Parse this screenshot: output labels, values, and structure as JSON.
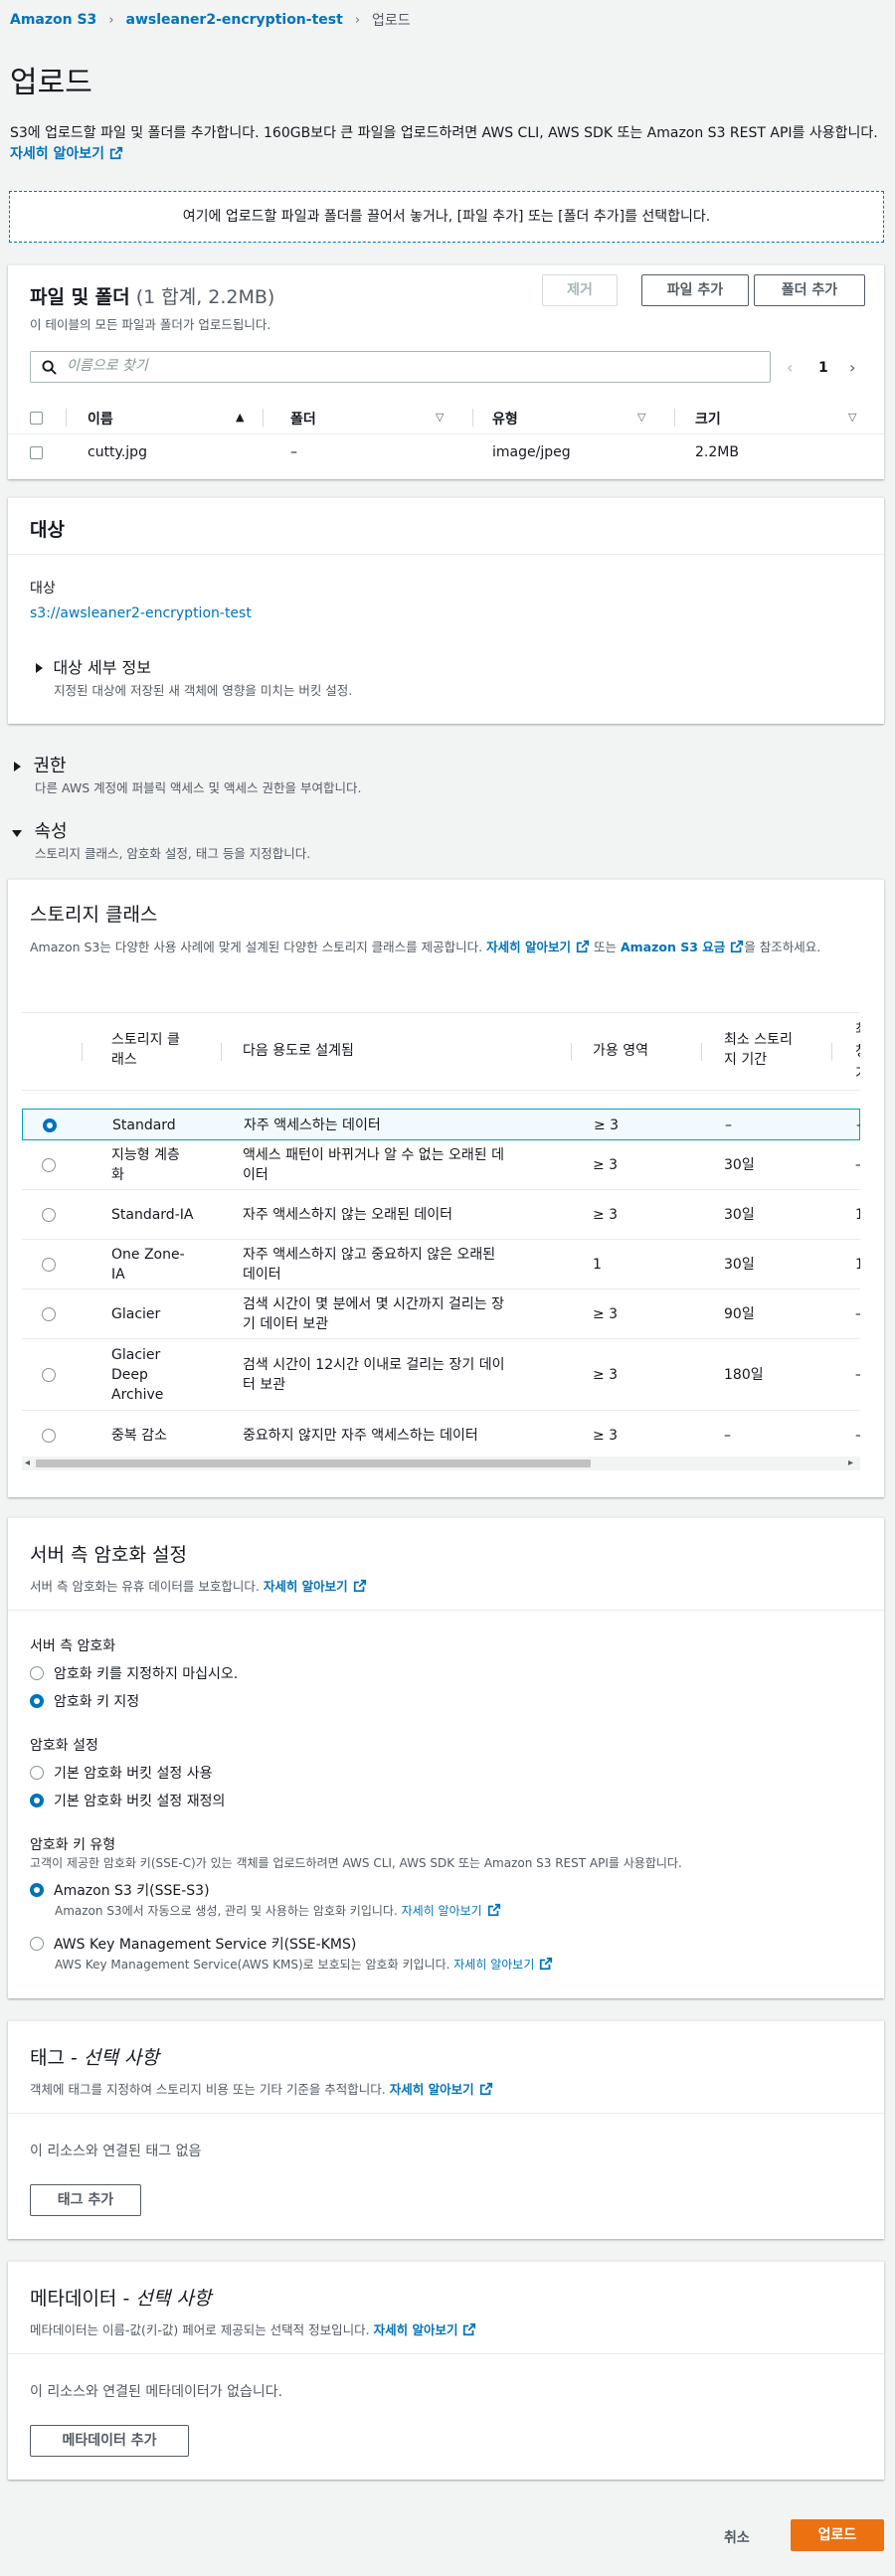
{
  "breadcrumb": {
    "root": "Amazon S3",
    "bucket": "awsleaner2-encryption-test",
    "current": "업로드"
  },
  "page_title": "업로드",
  "intro": {
    "text": "S3에 업로드할 파일 및 폴더를 추가합니다. 160GB보다 큰 파일을 업로드하려면 AWS CLI, AWS SDK 또는 Amazon S3 REST API를 사용합니다.",
    "link": "자세히 알아보기"
  },
  "dropzone": {
    "text": "여기에 업로드할 파일과 폴더를 끌어서 놓거나, [파일 추가] 또는 [폴더 추가]를 선택합니다."
  },
  "files": {
    "title": "파일 및 폴더",
    "count": "(1 합계, 2.2MB)",
    "subtitle": "이 테이블의 모든 파일과 폴더가 업로드됩니다.",
    "remove_label": "제거",
    "add_files_label": "파일 추가",
    "add_folder_label": "폴더 추가",
    "search_placeholder": "이름으로 찾기",
    "page_number": "1",
    "columns": [
      "이름",
      "폴더",
      "유형",
      "크기"
    ],
    "rows": [
      {
        "name": "cutty.jpg",
        "folder": "–",
        "type": "image/jpeg",
        "size": "2.2MB"
      }
    ]
  },
  "destination": {
    "title": "대상",
    "label": "대상",
    "value": "s3://awsleaner2-encryption-test",
    "details_title": "대상 세부 정보",
    "details_desc": "지정된 대상에 저장된 새 객체에 영향을 미치는 버킷 설정."
  },
  "permissions": {
    "title": "권한",
    "desc": "다른 AWS 계정에 퍼블릭 액세스 및 액세스 권한을 부여합니다."
  },
  "properties": {
    "title": "속성",
    "desc": "스토리지 클래스, 암호화 설정, 태그 등을 지정합니다."
  },
  "storage": {
    "title": "스토리지 클래스",
    "desc_a": "Amazon S3는 다양한 사용 사례에 맞게 설계된 다양한 스토리지 클래스를 제공합니다.",
    "link_learn": "자세히 알아보기",
    "desc_b": "또는",
    "link_pricing": "Amazon S3 요금",
    "desc_c": "을 참조하세요.",
    "columns": {
      "class_a": "스토리지 클",
      "class_b": "래스",
      "use": "다음 용도로 설계됨",
      "az": "가용 영역",
      "min_a": "최소 스토리",
      "min_b": "지 기간",
      "cut_a": "최",
      "cut_b": "청",
      "cut_c": "기"
    },
    "rows": [
      {
        "name_a": "Standard",
        "name_b": "",
        "name_c": "",
        "use_a": "자주 액세스하는 데이터",
        "use_b": "",
        "az": "≥ 3",
        "min": "–",
        "extra": "–",
        "selected": true
      },
      {
        "name_a": "지능형 계층",
        "name_b": "화",
        "name_c": "",
        "use_a": "액세스 패턴이 바뀌거나 알 수 없는 오래된 데",
        "use_b": "이터",
        "az": "≥ 3",
        "min": "30일",
        "extra": "–",
        "selected": false
      },
      {
        "name_a": "Standard-IA",
        "name_b": "",
        "name_c": "",
        "use_a": "자주 액세스하지 않는 오래된 데이터",
        "use_b": "",
        "az": "≥ 3",
        "min": "30일",
        "extra": "1",
        "selected": false
      },
      {
        "name_a": "One Zone-",
        "name_b": "IA",
        "name_c": "",
        "use_a": "자주 액세스하지 않고 중요하지 않은 오래된",
        "use_b": "데이터",
        "az": "1",
        "min": "30일",
        "extra": "1",
        "selected": false
      },
      {
        "name_a": "Glacier",
        "name_b": "",
        "name_c": "",
        "use_a": "검색 시간이 몇 분에서 몇 시간까지 걸리는 장",
        "use_b": "기 데이터 보관",
        "az": "≥ 3",
        "min": "90일",
        "extra": "–",
        "selected": false
      },
      {
        "name_a": "Glacier",
        "name_b": "Deep",
        "name_c": "Archive",
        "use_a": "검색 시간이 12시간 이내로 걸리는 장기 데이",
        "use_b": "터 보관",
        "az": "≥ 3",
        "min": "180일",
        "extra": "–",
        "selected": false
      },
      {
        "name_a": "중복 감소",
        "name_b": "",
        "name_c": "",
        "use_a": "중요하지 않지만 자주 액세스하는 데이터",
        "use_b": "",
        "az": "≥ 3",
        "min": "–",
        "extra": "–",
        "selected": false
      }
    ]
  },
  "encryption": {
    "title": "서버 측 암호화 설정",
    "desc": "서버 측 암호화는 유휴 데이터를 보호합니다.",
    "link": "자세히 알아보기",
    "sse_label": "서버 측 암호화",
    "sse_opt1": "암호화 키를 지정하지 마십시오.",
    "sse_opt2": "암호화 키 지정",
    "setting_label": "암호화 설정",
    "setting_opt1": "기본 암호화 버킷 설정 사용",
    "setting_opt2": "기본 암호화 버킷 설정 재정의",
    "keytype_label": "암호화 키 유형",
    "keytype_desc": "고객이 제공한 암호화 키(SSE-C)가 있는 객체를 업로드하려면 AWS CLI, AWS SDK 또는 Amazon S3 REST API를 사용합니다.",
    "key_opt1": "Amazon S3 키(SSE-S3)",
    "key_opt1_desc": "Amazon S3에서 자동으로 생성, 관리 및 사용하는 암호화 키입니다.",
    "key_opt2": "AWS Key Management Service 키(SSE-KMS)",
    "key_opt2_desc": "AWS Key Management Service(AWS KMS)로 보호되는 암호화 키입니다."
  },
  "tags": {
    "title": "태그 - ",
    "title_optional": "선택 사항",
    "desc": "객체에 태그를 지정하여 스토리지 비용 또는 기타 기준을 추적합니다.",
    "link": "자세히 알아보기",
    "empty": "이 리소스와 연결된 태그 없음",
    "add_label": "태그 추가"
  },
  "metadata": {
    "title": "메타데이터 - ",
    "title_optional": "선택 사항",
    "desc": "메타데이터는 이름-값(키-값) 페어로 제공되는 선택적 정보입니다.",
    "link": "자세히 알아보기",
    "empty": "이 리소스와 연결된 메타데이터가 없습니다.",
    "add_label": "메타데이터 추가"
  },
  "footer": {
    "cancel_label": "취소",
    "upload_label": "업로드"
  },
  "colors": {
    "link": "#0073bb",
    "primary": "#ec7211",
    "selected_border": "#00a1c9"
  }
}
